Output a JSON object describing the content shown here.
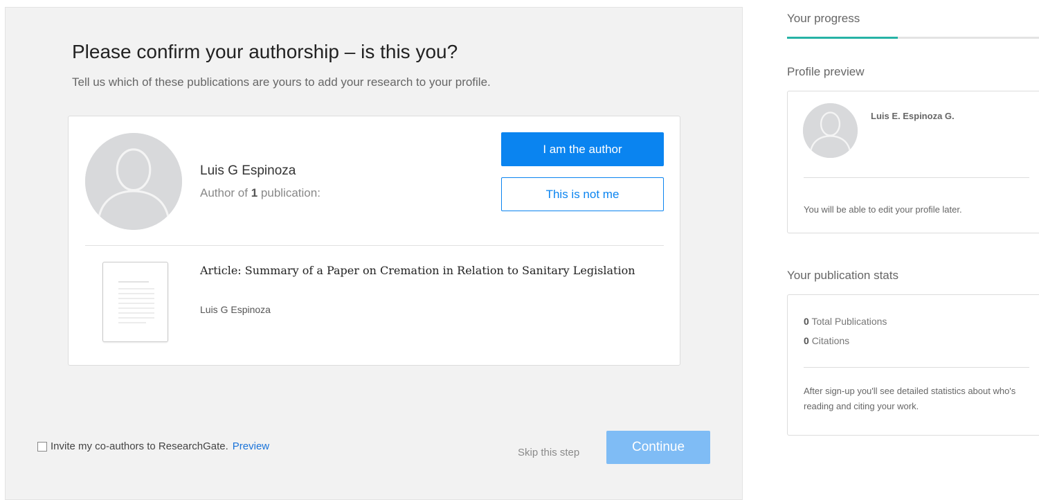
{
  "main": {
    "title": "Please confirm your authorship – is this you?",
    "subtitle": "Tell us which of these publications are yours to add your research to your profile.",
    "author": {
      "name": "Luis G Espinoza",
      "meta_prefix": "Author of ",
      "publication_count": "1",
      "meta_suffix": " publication:"
    },
    "buttons": {
      "confirm": "I am the author",
      "reject": "This is not me"
    },
    "publication": {
      "title": "Article: Summary of a Paper on Cremation in Relation to Sanitary Legislation",
      "authors": "Luis G Espinoza"
    },
    "footer": {
      "invite_label": "Invite my co-authors to ResearchGate.",
      "invite_checked": false,
      "preview_link": "Preview",
      "skip_label": "Skip this step",
      "continue_label": "Continue"
    }
  },
  "sidebar": {
    "progress": {
      "heading": "Your progress",
      "value": 0.44,
      "color": "#26b3a6"
    },
    "profile_preview": {
      "heading": "Profile preview",
      "name": "Luis E. Espinoza G.",
      "note": "You will be able to edit your profile later."
    },
    "stats": {
      "heading": "Your publication stats",
      "total_publications_value": "0",
      "total_publications_label": "Total Publications",
      "citations_value": "0",
      "citations_label": "Citations",
      "note": "After sign-up you'll see detailed statistics about who's reading and citing your work."
    }
  },
  "colors": {
    "primary": "#0a84f0",
    "continue_disabled": "#7fbcf5",
    "panel_bg": "#f2f2f2",
    "link": "#1a73d9"
  },
  "icons": {
    "avatar": "avatar-placeholder-icon",
    "document": "document-thumbnail-icon",
    "checkbox": "checkbox-unchecked-icon"
  }
}
